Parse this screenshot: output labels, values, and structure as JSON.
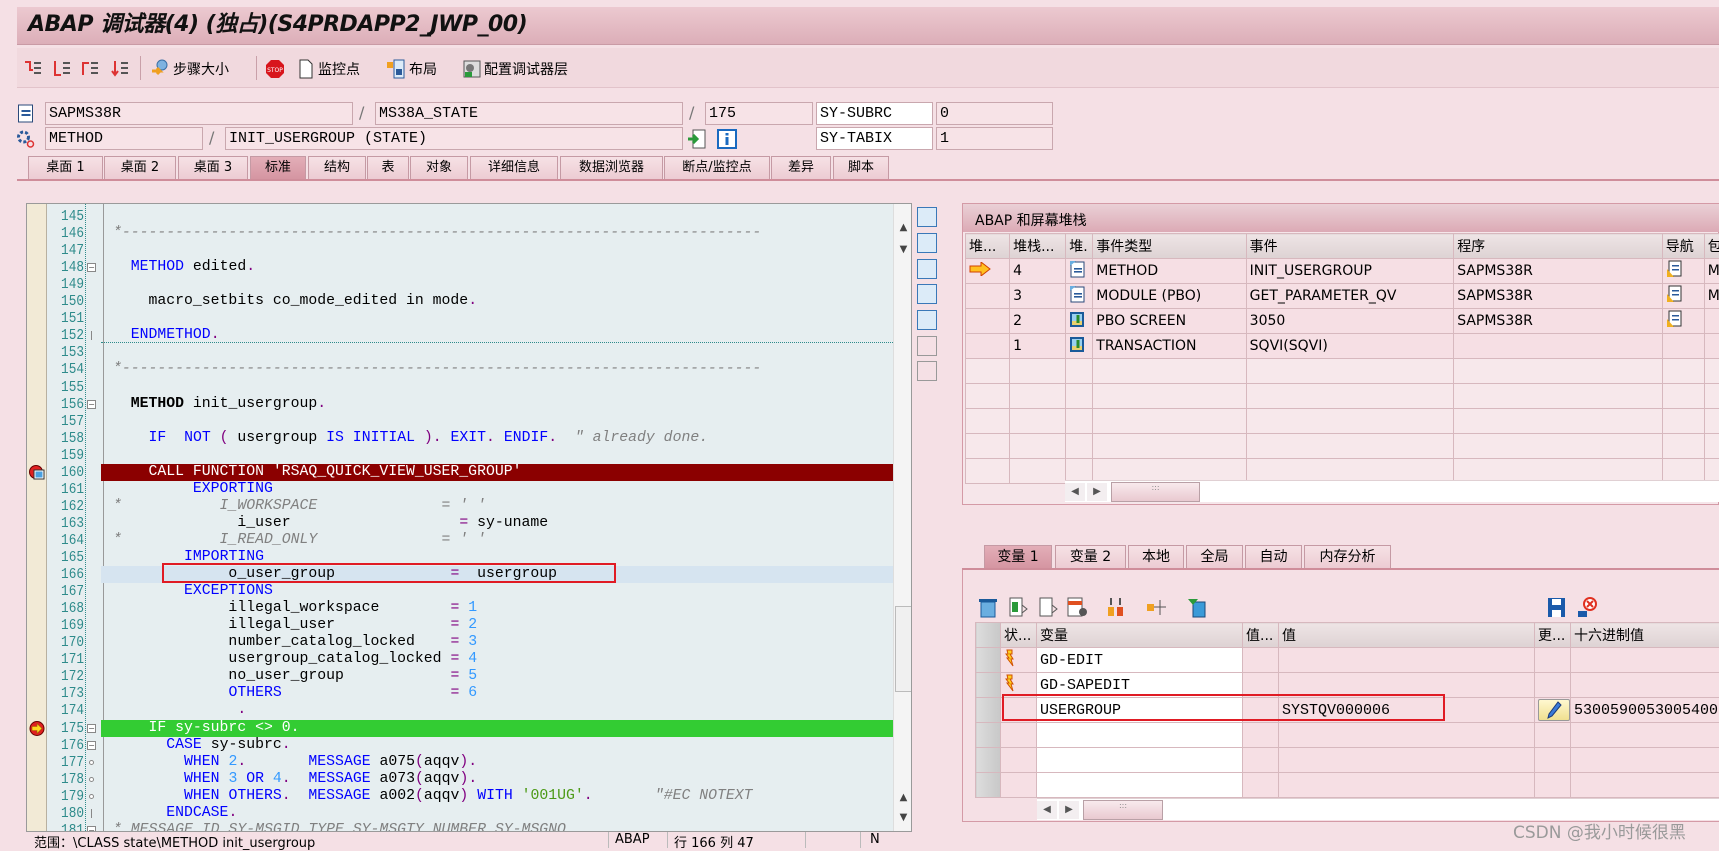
{
  "window": {
    "title": "ABAP 调试器(4) (独占)(S4PRDAPP2_JWP_00)"
  },
  "toolbar": {
    "step_icons": [
      "step-into-icon",
      "step-over-icon",
      "return-icon",
      "continue-icon"
    ],
    "step_size_label": "步骤大小",
    "stop_label": "STOP",
    "watchpoint_label": "监控点",
    "layout_label": "布局",
    "config_label": "配置调试器层"
  },
  "context": {
    "program": "SAPMS38R",
    "include": "MS38A_STATE",
    "line": "175",
    "event_type": "METHOD",
    "event": "INIT_USERGROUP (STATE)",
    "sy_subrc_label": "SY-SUBRC",
    "sy_subrc_value": "0",
    "sy_tabix_label": "SY-TABIX",
    "sy_tabix_value": "1"
  },
  "tabs": [
    "桌面 1",
    "桌面 2",
    "桌面 3",
    "标准",
    "结构",
    "表",
    "对象",
    "详细信息",
    "数据浏览器",
    "断点/监控点",
    "差异",
    "脚本"
  ],
  "active_tab": "标准",
  "code": {
    "highlight_colors": {
      "breakpoint_line": "#8b0000",
      "current_line": "#33cc33",
      "cursor_line": "#d6e4f0"
    },
    "lines": [
      {
        "no": "145",
        "tokens": []
      },
      {
        "no": "146",
        "tokens": [
          [
            "*------------------------------------------------------------------------",
            "c"
          ]
        ]
      },
      {
        "no": "147",
        "tokens": []
      },
      {
        "no": "148",
        "fold": "box",
        "tokens": [
          [
            "  ",
            "t"
          ],
          [
            "METHOD",
            "k"
          ],
          [
            " edited",
            "t"
          ],
          [
            ".",
            "p"
          ]
        ]
      },
      {
        "no": "149",
        "tokens": []
      },
      {
        "no": "150",
        "tokens": [
          [
            "    macro_setbits co_mode_edited in mode",
            "t"
          ],
          [
            ".",
            "p"
          ]
        ]
      },
      {
        "no": "151",
        "tokens": []
      },
      {
        "no": "152",
        "fold": "tick",
        "underline": true,
        "tokens": [
          [
            "  ",
            "t"
          ],
          [
            "ENDMETHOD",
            "k"
          ],
          [
            ".",
            "p"
          ]
        ]
      },
      {
        "no": "153",
        "tokens": []
      },
      {
        "no": "154",
        "tokens": [
          [
            "*------------------------------------------------------------------------",
            "c"
          ]
        ]
      },
      {
        "no": "155",
        "tokens": []
      },
      {
        "no": "156",
        "fold": "box",
        "tokens": [
          [
            "  ",
            "t"
          ],
          [
            "METHOD",
            "b"
          ],
          [
            " init_usergroup",
            "t"
          ],
          [
            ".",
            "p"
          ]
        ]
      },
      {
        "no": "157",
        "tokens": []
      },
      {
        "no": "158",
        "tokens": [
          [
            "    ",
            "t"
          ],
          [
            "IF",
            "k"
          ],
          [
            "  ",
            "t"
          ],
          [
            "NOT",
            "k"
          ],
          [
            " ",
            "t"
          ],
          [
            "(",
            "p"
          ],
          [
            " usergroup ",
            "t"
          ],
          [
            "IS INITIAL",
            "k"
          ],
          [
            " ",
            "t"
          ],
          [
            ").",
            "p"
          ],
          [
            " ",
            "t"
          ],
          [
            "EXIT",
            "k"
          ],
          [
            ".",
            "p"
          ],
          [
            " ",
            "t"
          ],
          [
            "ENDIF",
            "k"
          ],
          [
            ".",
            "p"
          ],
          [
            "  ",
            "t"
          ],
          [
            "\" already done.",
            "c"
          ]
        ]
      },
      {
        "no": "159",
        "tokens": []
      },
      {
        "no": "160",
        "marker": "breakpoint",
        "highlight": "red",
        "tokens": [
          [
            "    CALL FUNCTION 'RSAQ_QUICK_VIEW_USER_GROUP'",
            "t"
          ]
        ]
      },
      {
        "no": "161",
        "tokens": [
          [
            "         ",
            "t"
          ],
          [
            "EXPORTING",
            "k"
          ]
        ]
      },
      {
        "no": "162",
        "tokens": [
          [
            "*           I_WORKSPACE              = ' '",
            "c"
          ]
        ]
      },
      {
        "no": "163",
        "tokens": [
          [
            "              i_user                   ",
            "t"
          ],
          [
            "=",
            "p"
          ],
          [
            " sy-uname",
            "t"
          ]
        ]
      },
      {
        "no": "164",
        "tokens": [
          [
            "*           I_READ_ONLY              = ' '",
            "c"
          ]
        ]
      },
      {
        "no": "165",
        "tokens": [
          [
            "        ",
            "t"
          ],
          [
            "IMPORTING",
            "k"
          ]
        ]
      },
      {
        "no": "166",
        "highlight": "blue",
        "tokens": [
          [
            "             o_user_group             ",
            "t"
          ],
          [
            "=",
            "p"
          ],
          [
            "  usergroup",
            "t"
          ]
        ]
      },
      {
        "no": "167",
        "tokens": [
          [
            "        ",
            "t"
          ],
          [
            "EXCEPTIONS",
            "k"
          ]
        ]
      },
      {
        "no": "168",
        "tokens": [
          [
            "             illegal_workspace        ",
            "t"
          ],
          [
            "=",
            "p"
          ],
          [
            " ",
            "t"
          ],
          [
            "1",
            "n"
          ]
        ]
      },
      {
        "no": "169",
        "tokens": [
          [
            "             illegal_user             ",
            "t"
          ],
          [
            "=",
            "p"
          ],
          [
            " ",
            "t"
          ],
          [
            "2",
            "n"
          ]
        ]
      },
      {
        "no": "170",
        "tokens": [
          [
            "             number_catalog_locked    ",
            "t"
          ],
          [
            "=",
            "p"
          ],
          [
            " ",
            "t"
          ],
          [
            "3",
            "n"
          ]
        ]
      },
      {
        "no": "171",
        "tokens": [
          [
            "             usergroup_catalog_locked ",
            "t"
          ],
          [
            "=",
            "p"
          ],
          [
            " ",
            "t"
          ],
          [
            "4",
            "n"
          ]
        ]
      },
      {
        "no": "172",
        "tokens": [
          [
            "             no_user_group            ",
            "t"
          ],
          [
            "=",
            "p"
          ],
          [
            " ",
            "t"
          ],
          [
            "5",
            "n"
          ]
        ]
      },
      {
        "no": "173",
        "tokens": [
          [
            "             ",
            "t"
          ],
          [
            "OTHERS",
            "k"
          ],
          [
            "                   ",
            "t"
          ],
          [
            "=",
            "p"
          ],
          [
            " ",
            "t"
          ],
          [
            "6",
            "n"
          ]
        ]
      },
      {
        "no": "174",
        "tokens": [
          [
            "              .",
            "p"
          ]
        ]
      },
      {
        "no": "175",
        "marker": "current",
        "highlight": "green",
        "fold": "box",
        "tokens": [
          [
            "    IF sy-subrc <> 0.",
            "t"
          ]
        ]
      },
      {
        "no": "176",
        "fold": "box",
        "tokens": [
          [
            "      ",
            "t"
          ],
          [
            "CASE",
            "k"
          ],
          [
            " sy-subrc",
            "t"
          ],
          [
            ".",
            "p"
          ]
        ]
      },
      {
        "no": "177",
        "fold": "dot",
        "tokens": [
          [
            "        ",
            "t"
          ],
          [
            "WHEN",
            "k"
          ],
          [
            " ",
            "t"
          ],
          [
            "2",
            "n"
          ],
          [
            ".",
            "p"
          ],
          [
            "       ",
            "t"
          ],
          [
            "MESSAGE",
            "k"
          ],
          [
            " a075",
            "t"
          ],
          [
            "(",
            "p"
          ],
          [
            "aqqv",
            "t"
          ],
          [
            ").",
            "p"
          ]
        ]
      },
      {
        "no": "178",
        "fold": "dot",
        "tokens": [
          [
            "        ",
            "t"
          ],
          [
            "WHEN",
            "k"
          ],
          [
            " ",
            "t"
          ],
          [
            "3",
            "n"
          ],
          [
            " ",
            "t"
          ],
          [
            "OR",
            "k"
          ],
          [
            " ",
            "t"
          ],
          [
            "4",
            "n"
          ],
          [
            ".",
            "p"
          ],
          [
            "  ",
            "t"
          ],
          [
            "MESSAGE",
            "k"
          ],
          [
            " a073",
            "t"
          ],
          [
            "(",
            "p"
          ],
          [
            "aqqv",
            "t"
          ],
          [
            ").",
            "p"
          ]
        ]
      },
      {
        "no": "179",
        "fold": "dot",
        "tokens": [
          [
            "        ",
            "t"
          ],
          [
            "WHEN",
            "k"
          ],
          [
            " ",
            "t"
          ],
          [
            "OTHERS",
            "k"
          ],
          [
            ".",
            "p"
          ],
          [
            "  ",
            "t"
          ],
          [
            "MESSAGE",
            "k"
          ],
          [
            " a002",
            "t"
          ],
          [
            "(",
            "p"
          ],
          [
            "aqqv",
            "t"
          ],
          [
            ")",
            "p"
          ],
          [
            " ",
            "t"
          ],
          [
            "WITH",
            "k"
          ],
          [
            " ",
            "t"
          ],
          [
            "'001UG'",
            "s"
          ],
          [
            ".",
            "p"
          ],
          [
            "       ",
            "t"
          ],
          [
            "\"#EC NOTEXT",
            "c"
          ]
        ]
      },
      {
        "no": "180",
        "fold": "tick",
        "tokens": [
          [
            "      ",
            "t"
          ],
          [
            "ENDCASE",
            "k"
          ],
          [
            ".",
            "p"
          ]
        ]
      },
      {
        "no": "181",
        "fold": "box",
        "tokens": [
          [
            "* MESSAGE ID SY-MSGID TYPE SY-MSGTY NUMBER SY-MSGNO",
            "c"
          ]
        ]
      }
    ]
  },
  "status": {
    "scope": "范围：\\CLASS state\\METHOD init_usergroup",
    "lang": "ABAP",
    "position": "行 166 列 47",
    "mode": "N"
  },
  "stack": {
    "title": "ABAP 和屏幕堆栈",
    "columns": [
      "堆...",
      "堆栈...",
      "堆.",
      "事件类型",
      "事件",
      "程序",
      "导航",
      "包"
    ],
    "rows": [
      {
        "current": true,
        "level": "4",
        "icon": "method-icon",
        "type": "METHOD",
        "event": "INIT_USERGROUP",
        "program": "SAPMS38R",
        "nav": true,
        "extra": "M"
      },
      {
        "current": false,
        "level": "3",
        "icon": "module-icon",
        "type": "MODULE (PBO)",
        "event": "GET_PARAMETER_QV",
        "program": "SAPMS38R",
        "nav": true,
        "extra": "M"
      },
      {
        "current": false,
        "level": "2",
        "icon": "screen-icon",
        "type": "PBO SCREEN",
        "event": "3050",
        "program": "SAPMS38R",
        "nav": true,
        "extra": ""
      },
      {
        "current": false,
        "level": "1",
        "icon": "screen-icon",
        "type": "TRANSACTION",
        "event": "SQVI(SQVI)",
        "program": "",
        "nav": false,
        "extra": ""
      }
    ]
  },
  "variables": {
    "tabs": [
      "变量 1",
      "变量 2",
      "本地",
      "全局",
      "自动",
      "内存分析"
    ],
    "active_tab": "变量 1",
    "columns": [
      "状...",
      "变量",
      "值...",
      "值",
      "更...",
      "十六进制值"
    ],
    "rows": [
      {
        "status_icon": true,
        "name": "GD-EDIT",
        "value": "",
        "editable": false,
        "hex": ""
      },
      {
        "status_icon": true,
        "name": "GD-SAPEDIT",
        "value": "",
        "editable": false,
        "hex": ""
      },
      {
        "status_icon": false,
        "name": "USERGROUP",
        "value": "SYSTQV000006",
        "editable": true,
        "hex": "5300590053005400"
      }
    ]
  },
  "watermark": "CSDN @我小时候很黑"
}
